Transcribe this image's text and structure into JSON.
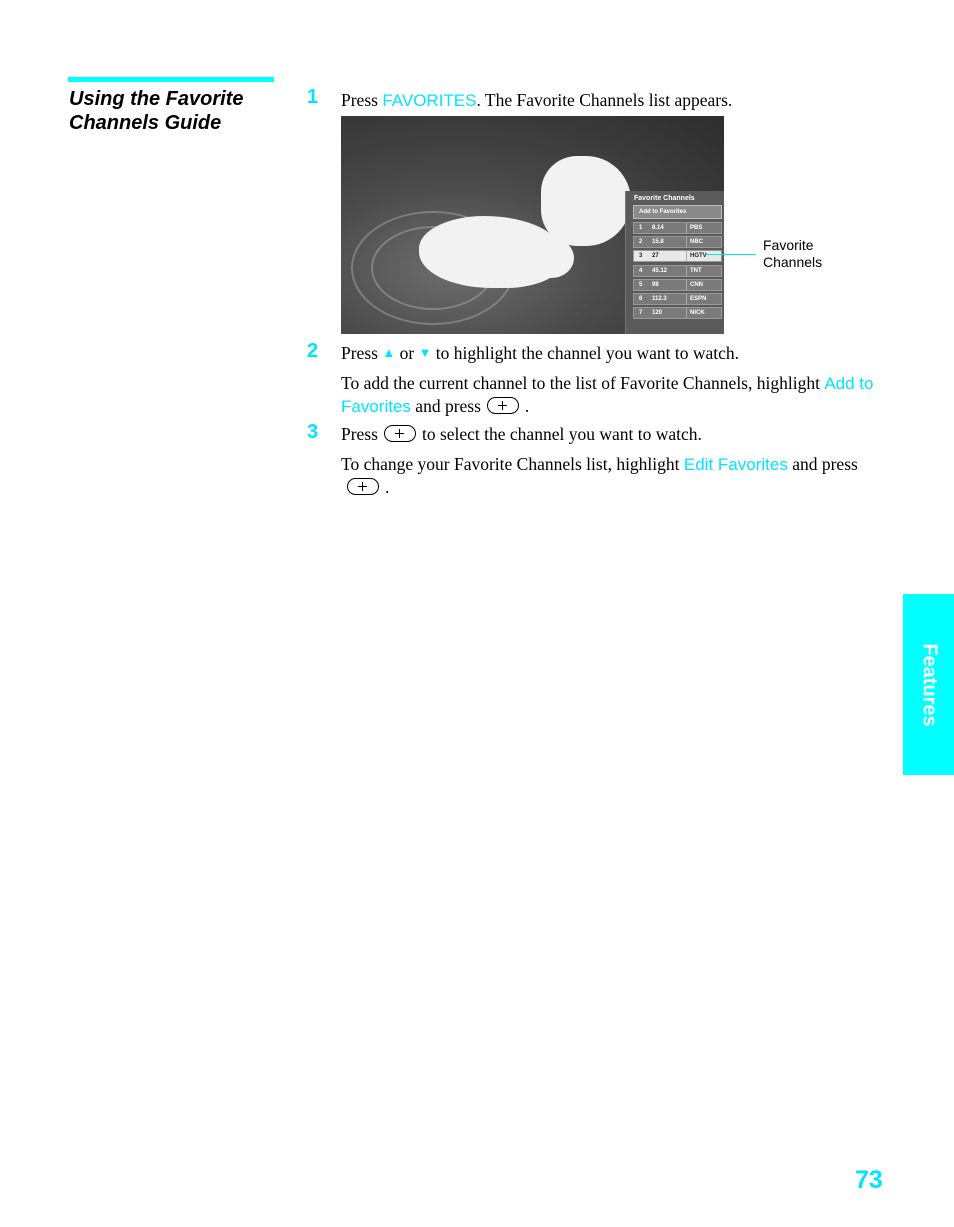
{
  "section": {
    "title_line1": "Using the Favorite",
    "title_line2": "Channels Guide"
  },
  "steps": [
    {
      "number": "1",
      "pre": "Press ",
      "highlight": "FAVORITES",
      "post": ". The Favorite Channels list appears."
    },
    {
      "number": "2",
      "pre": "Press ",
      "up_icon": "up-arrow-icon",
      "mid": " or ",
      "down_icon": "down-arrow-icon",
      "post": " to highlight the channel you want to watch.",
      "note_pre": "To add the current channel to the list of Favorite Channels, highlight ",
      "note_highlight": "Add to Favorites",
      "note_post": " and press",
      "note_end": "."
    },
    {
      "number": "3",
      "pre": "Press",
      "post": "to select the channel you want to watch.",
      "note_pre": "To change your Favorite Channels list, highlight ",
      "note_highlight": "Edit Favorites",
      "note_post": " and press",
      "note_end": "."
    }
  ],
  "screen": {
    "panel_title": "Favorite Channels",
    "add_label": "Add to Favorites",
    "channels": [
      {
        "n": "1",
        "ch": "8.14",
        "name": "PBS"
      },
      {
        "n": "2",
        "ch": "15.8",
        "name": "NBC"
      },
      {
        "n": "3",
        "ch": "27",
        "name": "HGTV",
        "selected": true
      },
      {
        "n": "4",
        "ch": "45.12",
        "name": "TNT"
      },
      {
        "n": "5",
        "ch": "98",
        "name": "CNN"
      },
      {
        "n": "6",
        "ch": "112.3",
        "name": "ESPN"
      },
      {
        "n": "7",
        "ch": "120",
        "name": "NICK"
      }
    ]
  },
  "callout": {
    "line1": "Favorite",
    "line2": "Channels"
  },
  "side_tab": "Features",
  "page_number": "73",
  "colors": {
    "accent": "#00ffff",
    "highlight_text": "#00e5ff"
  }
}
